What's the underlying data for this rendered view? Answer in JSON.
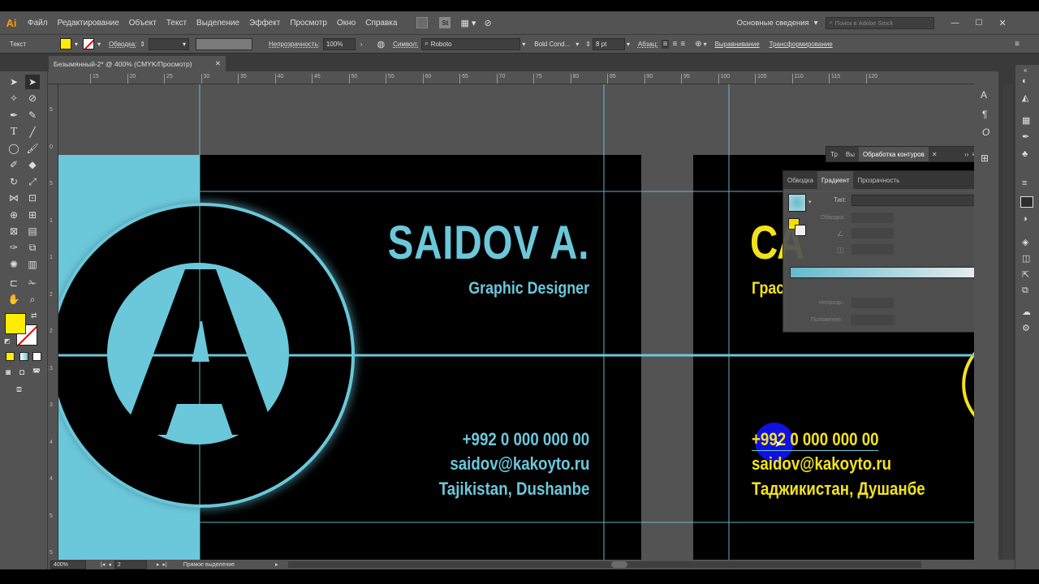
{
  "app": {
    "logo": "Ai"
  },
  "menu": [
    "Файл",
    "Редактирование",
    "Объект",
    "Текст",
    "Выделение",
    "Эффект",
    "Просмотр",
    "Окно",
    "Справка"
  ],
  "workspace": "Основные сведения",
  "stock_search_placeholder": "Поиск в Adobe Stock",
  "control": {
    "label_text": "Текст",
    "stroke_label": "Обводка:",
    "opacity_label": "Непрозрачность:",
    "opacity_value": "100%",
    "symbol_label": "Символ:",
    "font_name": "Roboto",
    "font_style": "Bold Cond...",
    "font_size": "8 pt",
    "paragraph_label": "Абзац:",
    "align_label": "Выравнивание",
    "transform_label": "Трансформирование"
  },
  "document_tab": "Безымянный-2* @ 400% (CMYK/Просмотр)",
  "ruler_h": [
    "15",
    "20",
    "25",
    "30",
    "35",
    "40",
    "45",
    "50",
    "55",
    "60",
    "65",
    "70",
    "75",
    "80",
    "85",
    "90",
    "95",
    "100",
    "105",
    "110",
    "115",
    "120"
  ],
  "ruler_v": [
    "5",
    "0",
    "5",
    "1",
    "1",
    "2",
    "2",
    "3",
    "3",
    "4",
    "4",
    "5",
    "5"
  ],
  "card_left": {
    "name": "SAIDOV A.",
    "title": "Graphic Designer",
    "phone": "+992 0 000 000 00",
    "email": "saidov@kakoyto.ru",
    "location": "Tajikistan, Dushanbe",
    "logo_letter": "A"
  },
  "card_right": {
    "name": "СА",
    "title": "Грас",
    "phone": "+992 0 000 000 00",
    "email": "saidov@kakoyto.ru",
    "location": "Таджикистан, Душанбе"
  },
  "panel_top": {
    "tabs": [
      "Тр",
      "Вы",
      "Обработка контуров"
    ]
  },
  "gradient_panel": {
    "tabs": [
      "Обводка",
      "Градиент",
      "Прозрачность"
    ],
    "type_label": "Тип:",
    "stroke_label": "Обводка:",
    "opacity_label": "Непрозр.:",
    "position_label": "Положение:"
  },
  "status": {
    "zoom": "400%",
    "page": "2",
    "tool": "Прямое выделение"
  },
  "colors": {
    "cyan": "#6bc7da",
    "yellow": "#f2e31a",
    "fill_swatch": "#ffec00",
    "ui": "#535353"
  }
}
